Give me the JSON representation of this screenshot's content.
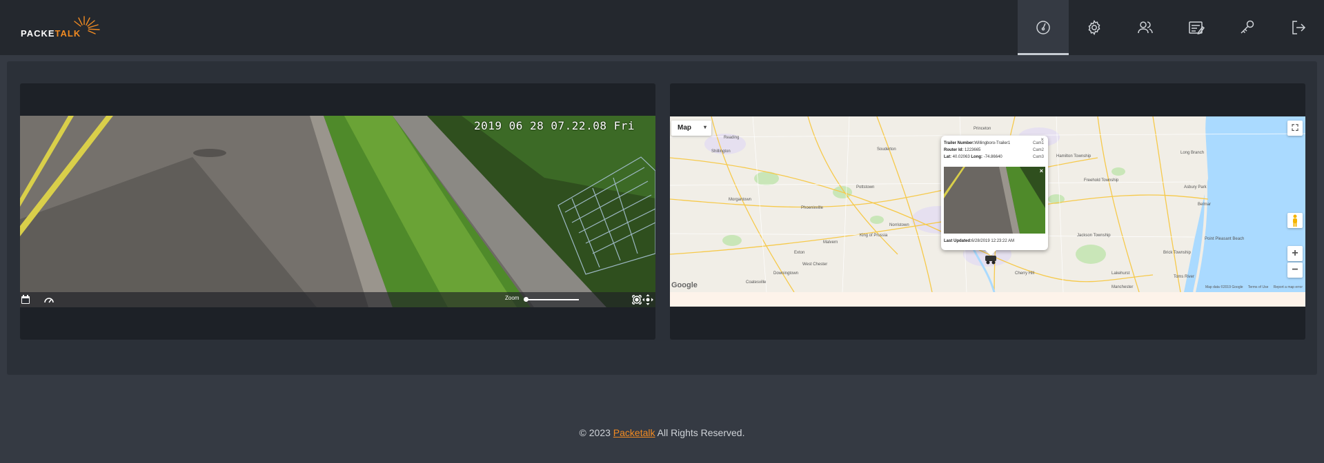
{
  "app": {
    "brand_part1": "PACKE",
    "brand_part2": "TALK",
    "brand_color": "#f28b22"
  },
  "nav": {
    "items": [
      {
        "icon": "dashboard-icon",
        "active": true
      },
      {
        "icon": "gear-icon",
        "active": false
      },
      {
        "icon": "users-icon",
        "active": false
      },
      {
        "icon": "notes-icon",
        "active": false
      },
      {
        "icon": "key-icon",
        "active": false
      },
      {
        "icon": "logout-icon",
        "active": false
      }
    ]
  },
  "camera": {
    "timestamp": "2019 06 28 07.22.08 Fri",
    "zoom_label": "Zoom",
    "zoom_level": 0.0
  },
  "map": {
    "type_label": "Map",
    "type_arrow": "▾",
    "zoom_in": "+",
    "zoom_out": "−",
    "fullscreen": "⛶",
    "google": "Google",
    "credits": [
      "Map data ©2019 Google",
      "Terms of Use",
      "Report a map error"
    ],
    "popup": {
      "trailer_label": "Trailer Number:",
      "trailer_value": "Willingboro-Trailer1",
      "router_label": "Router Id:",
      "router_value": "1223665",
      "lat_label": "Lat:",
      "lat_value": "40.02063",
      "long_label": "Long:",
      "long_value": "-74.86640",
      "cams": [
        "Cam1",
        "Cam2",
        "Cam3"
      ],
      "close": "×",
      "updated_label": "Last Updated:",
      "updated_value": "6/28/2019 12:23:22 AM"
    },
    "towns": [
      "Reading",
      "Shillington",
      "Pottstown",
      "Souderton",
      "Princeton",
      "Hamilton Township",
      "Morgantown",
      "Phoenixville",
      "King of Prussia",
      "Norristown",
      "Coatesville",
      "Downingtown",
      "West Chester",
      "Malvern",
      "Exton",
      "Cherry Hill",
      "Jackson Township",
      "Brick Township",
      "Toms River",
      "Lakehurst",
      "Manchester",
      "Freehold Township",
      "Long Branch",
      "Asbury Park",
      "Belmar",
      "Point Pleasant Beach"
    ]
  },
  "footer": {
    "prefix": "© 2023",
    "link": "Packetalk",
    "suffix": "All Rights Reserved."
  }
}
